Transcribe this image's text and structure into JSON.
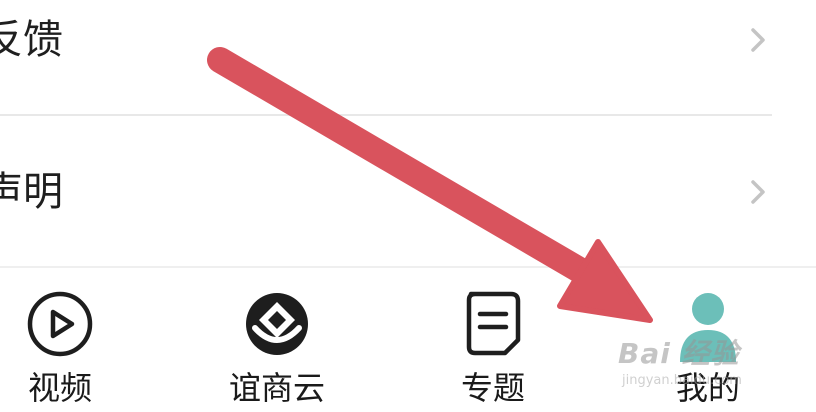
{
  "menu": {
    "items": [
      {
        "label": "反馈"
      },
      {
        "label": "声明"
      }
    ]
  },
  "tabbar": {
    "tabs": [
      {
        "label": "视频",
        "icon": "play-circle-icon"
      },
      {
        "label": "谊商云",
        "icon": "yishangyun-logo-icon"
      },
      {
        "label": "专题",
        "icon": "document-lines-icon"
      },
      {
        "label": "我的",
        "icon": "user-profile-icon"
      }
    ],
    "active_color": "#6cbfb9"
  },
  "annotation": {
    "arrow_color": "#d9535d"
  },
  "watermark": {
    "brand": "Bai 经验",
    "url": "jingyan.baidu.com"
  }
}
